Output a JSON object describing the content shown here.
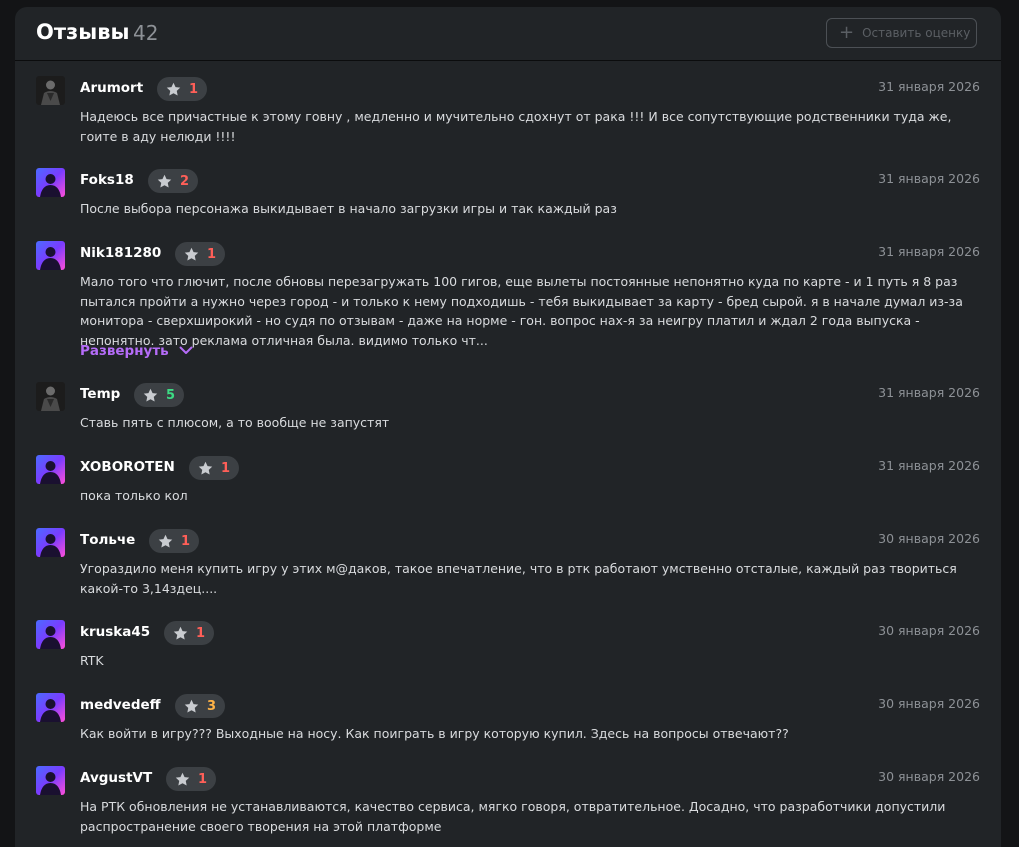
{
  "header": {
    "title": "Отзывы",
    "count": "42",
    "rate_button": "Оставить оценку"
  },
  "colors": {
    "low": "#ff5f58",
    "mid": "#ffb347",
    "high": "#3ddc84",
    "accent": "#b56cf8"
  },
  "reviews": [
    {
      "author": "Arumort",
      "rating": "1",
      "date": "31 января 2026",
      "avatar": "dark-figure",
      "text": "Надеюсь все причастные к этому говну , медленно и мучительно сдохнут от рака !!! И все сопутствующие родственники туда же, гоите в аду нелюди !!!!"
    },
    {
      "author": "Foks18",
      "rating": "2",
      "date": "31 января 2026",
      "avatar": "neon-silhouette",
      "text": "После выбора персонажа выкидывает в начало загрузки игры и так каждый раз"
    },
    {
      "author": "Nik181280",
      "rating": "1",
      "date": "31 января 2026",
      "avatar": "neon-silhouette",
      "text": "Мало того что глючит, после обновы перезагружать 100 гигов, еще вылеты постоянные непонятно куда по карте - и 1 путь я 8 раз пытался пройти а нужно через город - и только к нему подходишь - тебя выкидывает за карту - бред сырой. я в начале думал из-за монитора - сверхширокий - но судя по отзывам - даже на норме - гон. вопрос нах-я за неигру платил и ждал 2 года выпуска - непонятно. зато реклама отличная была. видимо только чт...",
      "expand": "Развернуть"
    },
    {
      "author": "Temp",
      "rating": "5",
      "date": "31 января 2026",
      "avatar": "dark-figure",
      "text": "Ставь пять с плюсом, а то вообще не запустят"
    },
    {
      "author": "XOBOROTEN",
      "rating": "1",
      "date": "31 января 2026",
      "avatar": "neon-silhouette",
      "text": "пока только кол"
    },
    {
      "author": "Тольче",
      "rating": "1",
      "date": "30 января 2026",
      "avatar": "neon-silhouette",
      "text": "Угораздило меня купить игру у этих м@даков, такое впечатление, что в ртк работают умственно отсталые, каждый раз твориться какой-то 3,14здец...."
    },
    {
      "author": "kruska45",
      "rating": "1",
      "date": "30 января 2026",
      "avatar": "neon-silhouette",
      "text": "RTK"
    },
    {
      "author": "medvedeff",
      "rating": "3",
      "date": "30 января 2026",
      "avatar": "neon-silhouette",
      "text": "Как войти в игру??? Выходные на носу. Как поиграть в игру которую купил. Здесь на вопросы отвечают??"
    },
    {
      "author": "AvgustVT",
      "rating": "1",
      "date": "30 января 2026",
      "avatar": "neon-silhouette",
      "text": "На РТК обновления не устанавливаются, качество сервиса, мягко говоря, отвратительное. Досадно, что разработчики допустили распространение своего творения на этой платформе"
    }
  ]
}
